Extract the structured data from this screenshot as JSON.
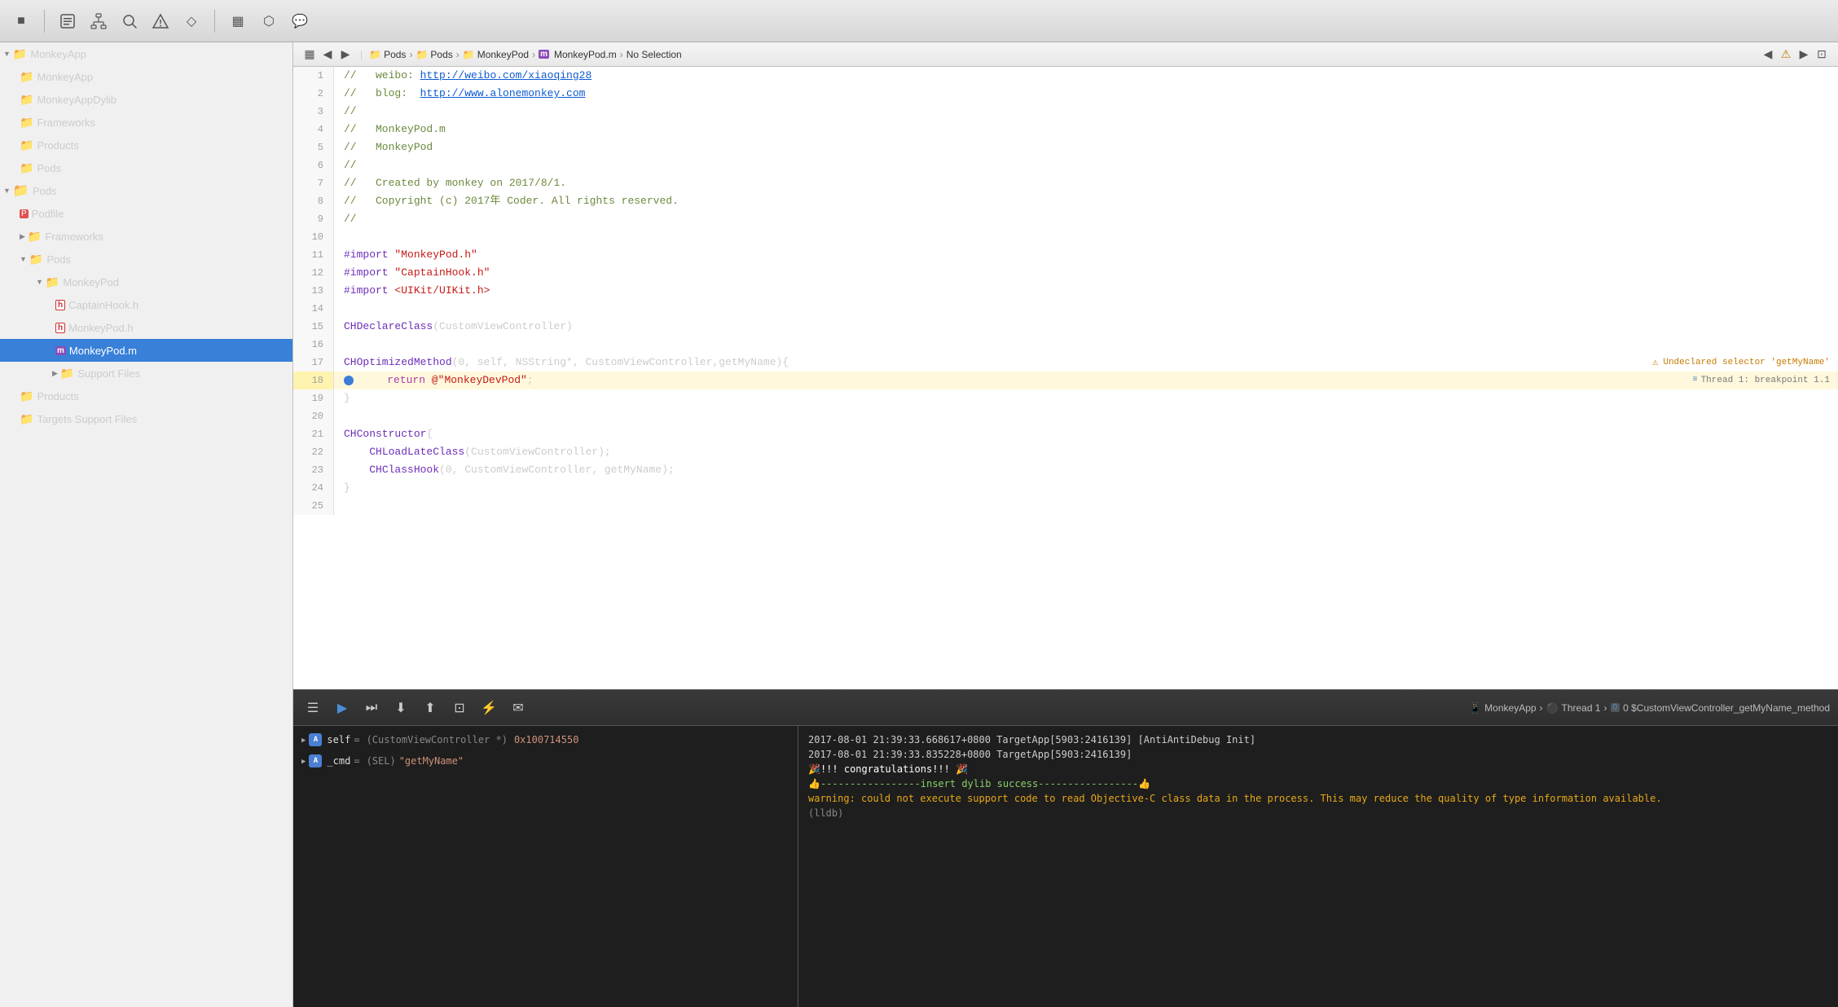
{
  "toolbar": {
    "icons": [
      {
        "name": "stop-icon",
        "symbol": "■",
        "label": "Stop"
      },
      {
        "name": "project-icon",
        "symbol": "⊡",
        "label": "Project"
      },
      {
        "name": "hierarchy-icon",
        "symbol": "⊞",
        "label": "Hierarchy"
      },
      {
        "name": "search-icon",
        "symbol": "🔍",
        "label": "Search"
      },
      {
        "name": "warning-icon",
        "symbol": "⚠",
        "label": "Warnings"
      },
      {
        "name": "bookmark-icon",
        "symbol": "◇",
        "label": "Bookmark"
      },
      {
        "name": "grid-icon",
        "symbol": "▦",
        "label": "Grid"
      },
      {
        "name": "tag-icon",
        "symbol": "⬡",
        "label": "Tags"
      },
      {
        "name": "comment-icon",
        "symbol": "💬",
        "label": "Comment"
      }
    ],
    "editor_icons": [
      {
        "name": "grid-view-icon",
        "symbol": "▦"
      },
      {
        "name": "nav-back-icon",
        "symbol": "◀"
      },
      {
        "name": "nav-forward-icon",
        "symbol": "▶"
      }
    ]
  },
  "breadcrumb": {
    "items": [
      {
        "label": "Pods",
        "icon": "📁"
      },
      {
        "label": "Pods",
        "icon": "📁"
      },
      {
        "label": "MonkeyPod",
        "icon": "📁"
      },
      {
        "label": "MonkeyPod.m",
        "icon": "m"
      },
      {
        "label": "No Selection"
      }
    ],
    "right_icons": [
      "◀",
      "⚠",
      "▶",
      "⊡"
    ]
  },
  "sidebar": {
    "items": [
      {
        "label": "MonkeyApp",
        "indent": 0,
        "icon": "folder",
        "expanded": true
      },
      {
        "label": "MonkeyApp",
        "indent": 1,
        "icon": "folder-yellow"
      },
      {
        "label": "MonkeyAppDylib",
        "indent": 1,
        "icon": "folder-yellow"
      },
      {
        "label": "Frameworks",
        "indent": 1,
        "icon": "folder-yellow"
      },
      {
        "label": "Products",
        "indent": 1,
        "icon": "folder-yellow"
      },
      {
        "label": "Pods",
        "indent": 1,
        "icon": "folder-yellow"
      },
      {
        "label": "Pods",
        "indent": 0,
        "icon": "folder-blue",
        "expanded": true
      },
      {
        "label": "Podfile",
        "indent": 1,
        "icon": "podfile"
      },
      {
        "label": "Frameworks",
        "indent": 1,
        "icon": "folder-yellow",
        "expanded": false
      },
      {
        "label": "Pods",
        "indent": 1,
        "icon": "folder-yellow",
        "expanded": true
      },
      {
        "label": "MonkeyPod",
        "indent": 2,
        "icon": "folder-yellow",
        "expanded": true,
        "selected": false
      },
      {
        "label": "CaptainHook.h",
        "indent": 3,
        "icon": "h-file"
      },
      {
        "label": "MonkeyPod.h",
        "indent": 3,
        "icon": "h-file"
      },
      {
        "label": "MonkeyPod.m",
        "indent": 3,
        "icon": "m-file",
        "selected": true
      },
      {
        "label": "Support Files",
        "indent": 3,
        "icon": "folder-yellow",
        "expanded": false
      },
      {
        "label": "Products",
        "indent": 1,
        "icon": "folder-yellow"
      },
      {
        "label": "Targets Support Files",
        "indent": 1,
        "icon": "folder-yellow"
      }
    ]
  },
  "editor": {
    "lines": [
      {
        "num": 1,
        "content": "//   weibo: http://weibo.com/xiaoqing28",
        "type": "comment"
      },
      {
        "num": 2,
        "content": "//   blog:  http://www.alonemonkey.com",
        "type": "comment"
      },
      {
        "num": 3,
        "content": "//",
        "type": "comment"
      },
      {
        "num": 4,
        "content": "//   MonkeyPod.m",
        "type": "comment"
      },
      {
        "num": 5,
        "content": "//   MonkeyPod",
        "type": "comment"
      },
      {
        "num": 6,
        "content": "//",
        "type": "comment"
      },
      {
        "num": 7,
        "content": "//   Created by monkey on 2017/8/1.",
        "type": "comment"
      },
      {
        "num": 8,
        "content": "//   Copyright (c) 2017年 Coder. All rights reserved.",
        "type": "comment"
      },
      {
        "num": 9,
        "content": "//",
        "type": "comment"
      },
      {
        "num": 10,
        "content": "",
        "type": "normal"
      },
      {
        "num": 11,
        "content": "#import \"MonkeyPod.h\"",
        "type": "import"
      },
      {
        "num": 12,
        "content": "#import \"CaptainHook.h\"",
        "type": "import"
      },
      {
        "num": 13,
        "content": "#import <UIKit/UIKit.h>",
        "type": "import"
      },
      {
        "num": 14,
        "content": "",
        "type": "normal"
      },
      {
        "num": 15,
        "content": "CHDeclareClass(CustomViewController)",
        "type": "normal"
      },
      {
        "num": 16,
        "content": "",
        "type": "normal"
      },
      {
        "num": 17,
        "content": "CHOptimizedMethod(0, self, NSString*, CustomViewController,getMyName){",
        "type": "normal",
        "warning": "Undeclared selector 'getMyName'"
      },
      {
        "num": 18,
        "content": "    return @\"MonkeyDevPod\";",
        "type": "breakpoint",
        "badge": "Thread 1: breakpoint 1.1"
      },
      {
        "num": 19,
        "content": "}",
        "type": "normal"
      },
      {
        "num": 20,
        "content": "",
        "type": "normal"
      },
      {
        "num": 21,
        "content": "CHConstructor{",
        "type": "normal"
      },
      {
        "num": 22,
        "content": "    CHLoadLateClass(CustomViewController);",
        "type": "normal"
      },
      {
        "num": 23,
        "content": "    CHClassHook(0, CustomViewController, getMyName);",
        "type": "normal"
      },
      {
        "num": 24,
        "content": "}",
        "type": "normal"
      },
      {
        "num": 25,
        "content": "",
        "type": "normal"
      }
    ]
  },
  "debug": {
    "toolbar_icons": [
      "☰",
      "▶",
      "⏭",
      "⬆",
      "⬇",
      "⬅",
      "⚡",
      "✉"
    ],
    "breadcrumb": {
      "app": "MonkeyApp",
      "thread": "Thread 1",
      "frame": "0 $CustomViewController_getMyName_method"
    },
    "variables": [
      {
        "name": "self",
        "type": "(CustomViewController *)",
        "value": "0x100714550",
        "expanded": false
      },
      {
        "name": "_cmd",
        "type": "(SEL)",
        "value": "\"getMyName\"",
        "expanded": false
      }
    ],
    "console": [
      {
        "text": "2017-08-01 21:39:33.668617+0800 TargetApp[5903:2416139] [AntiAntiDebug Init]",
        "type": "normal"
      },
      {
        "text": "2017-08-01 21:39:33.835228+0800 TargetApp[5903:2416139]",
        "type": "normal"
      },
      {
        "text": "🎉!!! congratulations!!! 🎉",
        "type": "emoji"
      },
      {
        "text": "👍-----------------insert dylib success-----------------👍",
        "type": "success"
      },
      {
        "text": "warning: could not execute support code to read Objective-C class data in the process. This may reduce the quality of type information available.",
        "type": "warning"
      },
      {
        "text": "(lldb)",
        "type": "lldb"
      }
    ]
  }
}
